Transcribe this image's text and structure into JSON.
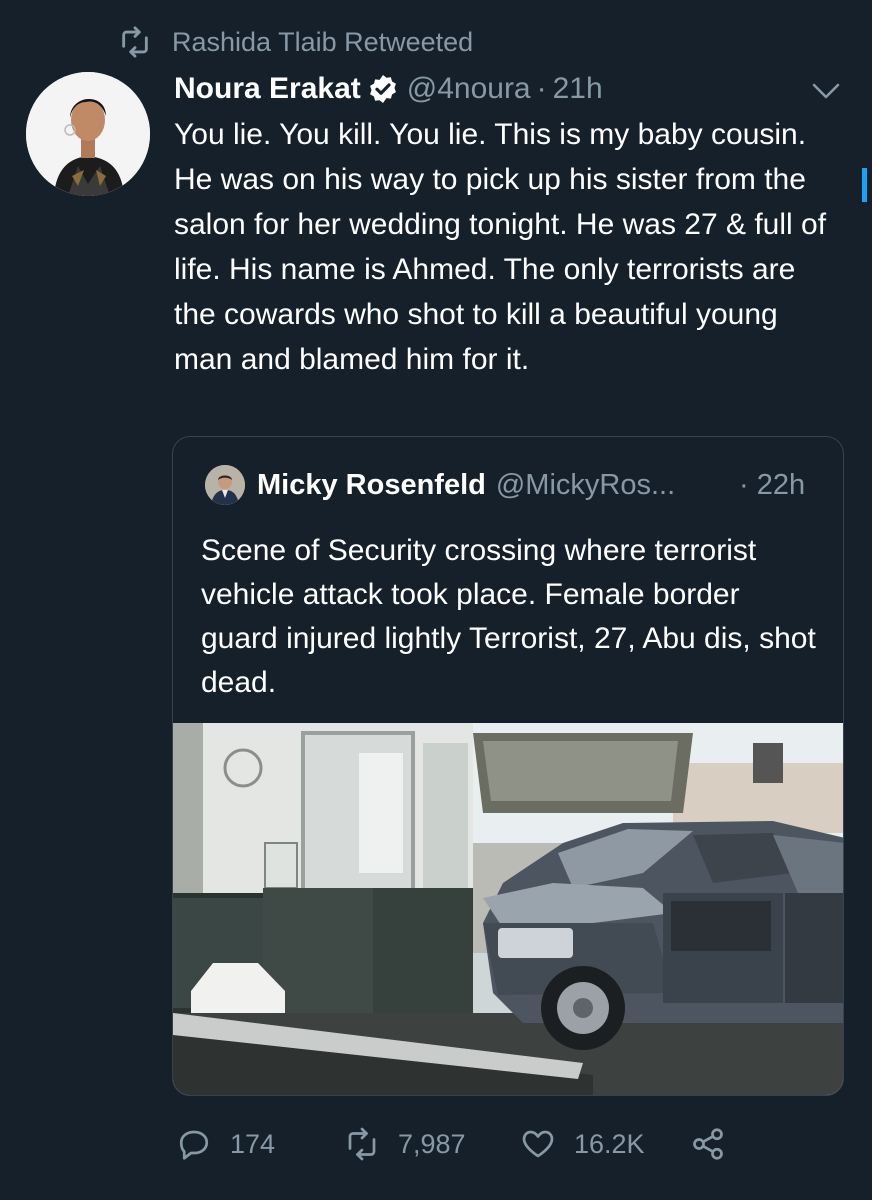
{
  "retweet_context": {
    "text": "Rashida Tlaib Retweeted",
    "icon": "retweet-icon"
  },
  "tweet": {
    "author_name": "Noura Erakat",
    "handle": "@4noura",
    "separator": "·",
    "time": "21h",
    "verified_icon": "verified-badge-icon",
    "text": "You lie. You kill. You lie. This is my baby cousin. He was on his way to pick up his sister from the salon for her wedding tonight. He was 27 & full of life. His name is Ahmed. The only terrorists are the cowards who shot to kill a beautiful young man and blamed him for it."
  },
  "quoted_tweet": {
    "author_name": "Micky Rosenfeld",
    "handle": "@MickyRos...",
    "time": "· 22h",
    "text": "Scene of Security crossing where terrorist vehicle attack took place. Female border guard injured lightly Terrorist, 27, Abu dis, shot dead."
  },
  "actions": {
    "replies": "174",
    "retweets": "7,987",
    "likes": "16.2K"
  },
  "colors": {
    "background": "#15202b",
    "secondary_text": "#8899a6",
    "border": "#38444d",
    "accent": "#1da1f2"
  }
}
